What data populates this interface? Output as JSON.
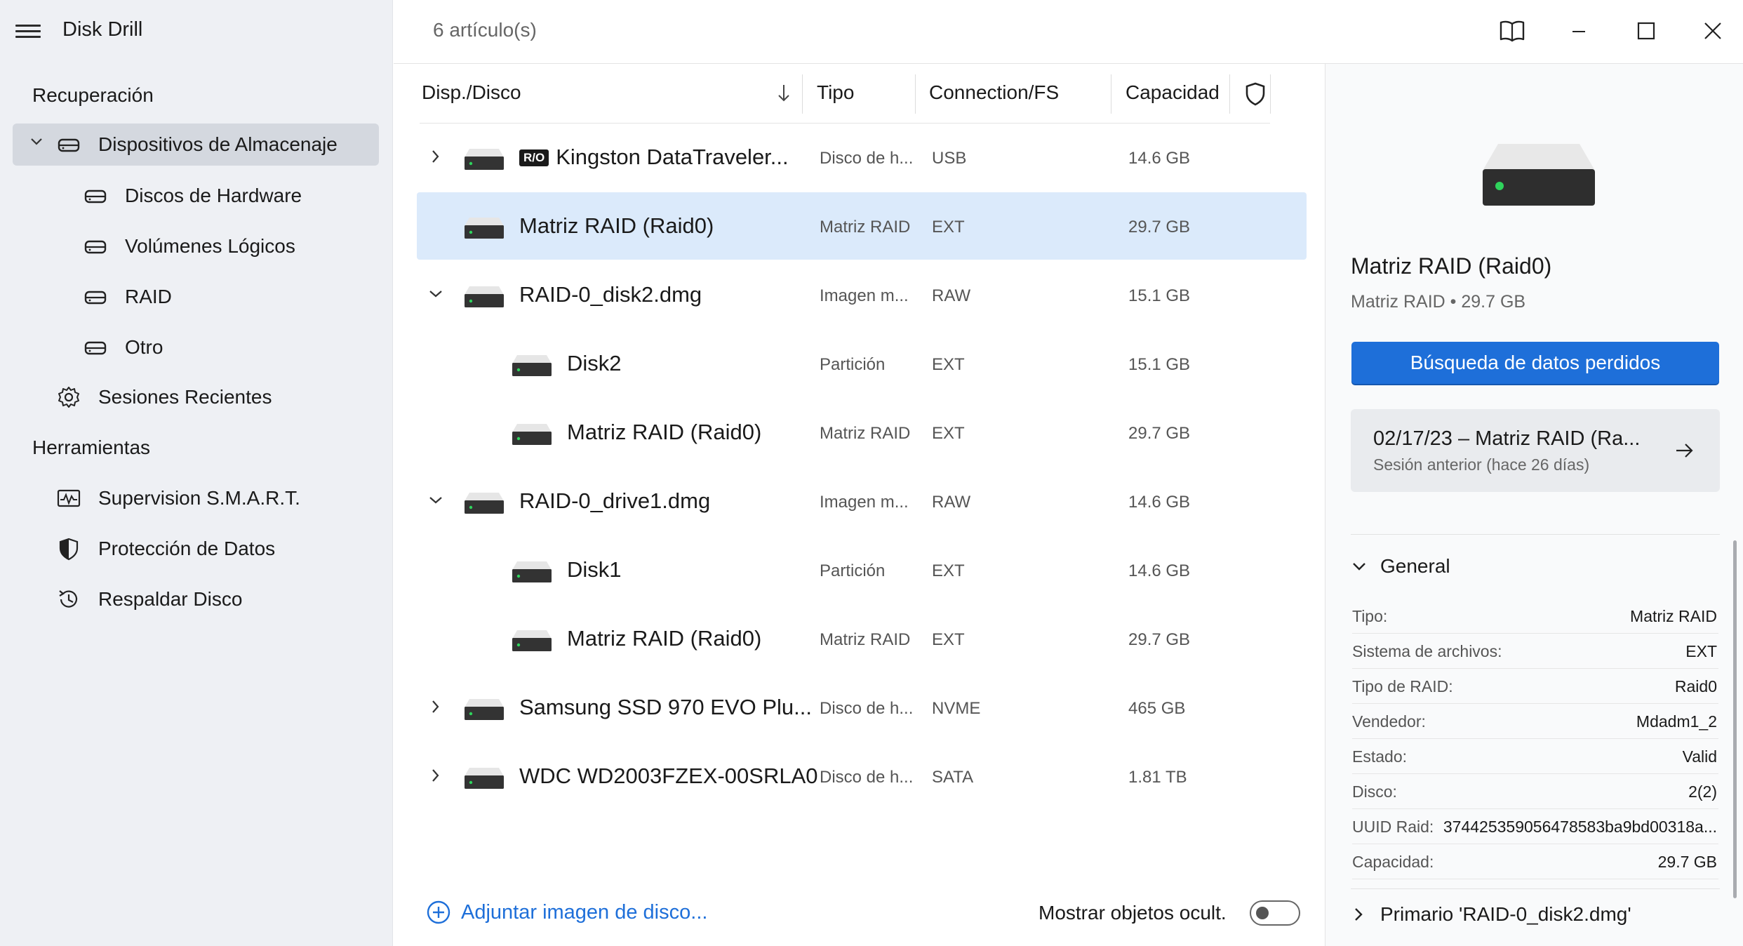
{
  "app": {
    "title": "Disk Drill"
  },
  "sidebar": {
    "recovery_heading": "Recuperación",
    "storage_devices": "Dispositivos de Almacenaje",
    "sub_items": [
      "Discos de Hardware",
      "Volúmenes Lógicos",
      "RAID",
      "Otro"
    ],
    "recent_sessions": "Sesiones Recientes",
    "tools_heading": "Herramientas",
    "tools": [
      "Supervision S.M.A.R.T.",
      "Protección de Datos",
      "Respaldar Disco"
    ]
  },
  "main": {
    "item_count": "6 artículo(s)",
    "columns": {
      "disk": "Disp./Disco",
      "type": "Tipo",
      "conn": "Connection/FS",
      "capacity": "Capacidad"
    },
    "rows": [
      {
        "name": "Kingston DataTraveler...",
        "ro": "R/O",
        "type": "Disco de h...",
        "fs": "USB",
        "capacity": "14.6 GB"
      },
      {
        "name": "Matriz RAID (Raid0)",
        "type": "Matriz RAID",
        "fs": "EXT",
        "capacity": "29.7 GB"
      },
      {
        "name": "RAID-0_disk2.dmg",
        "type": "Imagen m...",
        "fs": "RAW",
        "capacity": "15.1 GB"
      },
      {
        "name": "Disk2",
        "type": "Partición",
        "fs": "EXT",
        "capacity": "15.1 GB"
      },
      {
        "name": "Matriz RAID (Raid0)",
        "type": "Matriz RAID",
        "fs": "EXT",
        "capacity": "29.7 GB"
      },
      {
        "name": "RAID-0_drive1.dmg",
        "type": "Imagen m...",
        "fs": "RAW",
        "capacity": "14.6 GB"
      },
      {
        "name": "Disk1",
        "type": "Partición",
        "fs": "EXT",
        "capacity": "14.6 GB"
      },
      {
        "name": "Matriz RAID (Raid0)",
        "type": "Matriz RAID",
        "fs": "EXT",
        "capacity": "29.7 GB"
      },
      {
        "name": "Samsung SSD 970 EVO Plu...",
        "type": "Disco de h...",
        "fs": "NVME",
        "capacity": "465 GB"
      },
      {
        "name": "WDC WD2003FZEX-00SRLA0",
        "type": "Disco de h...",
        "fs": "SATA",
        "capacity": "1.81 TB"
      }
    ],
    "attach_label": "Adjuntar imagen de disco...",
    "show_hidden_label": "Mostrar objetos ocult."
  },
  "details": {
    "title": "Matriz RAID (Raid0)",
    "subtitle": "Matriz RAID • 29.7 GB",
    "search_button": "Búsqueda de datos perdidos",
    "session_title": "02/17/23 – Matriz RAID (Ra...",
    "session_sub": "Sesión anterior (hace 26 días)",
    "general_heading": "General",
    "props": [
      {
        "k": "Tipo:",
        "v": "Matriz RAID"
      },
      {
        "k": "Sistema de archivos:",
        "v": "EXT"
      },
      {
        "k": "Tipo de RAID:",
        "v": "Raid0"
      },
      {
        "k": "Vendedor:",
        "v": "Mdadm1_2"
      },
      {
        "k": "Estado:",
        "v": "Valid"
      },
      {
        "k": "Disco:",
        "v": "2(2)"
      },
      {
        "k": "UUID Raid:",
        "v": "374425359056478583ba9bd00318a..."
      },
      {
        "k": "Capacidad:",
        "v": "29.7 GB"
      }
    ],
    "primary_heading": "Primario 'RAID-0_disk2.dmg'"
  },
  "colors": {
    "accent": "#1e6fd9",
    "selection": "#dbeafb",
    "sidebar_bg": "#eef0f4"
  }
}
